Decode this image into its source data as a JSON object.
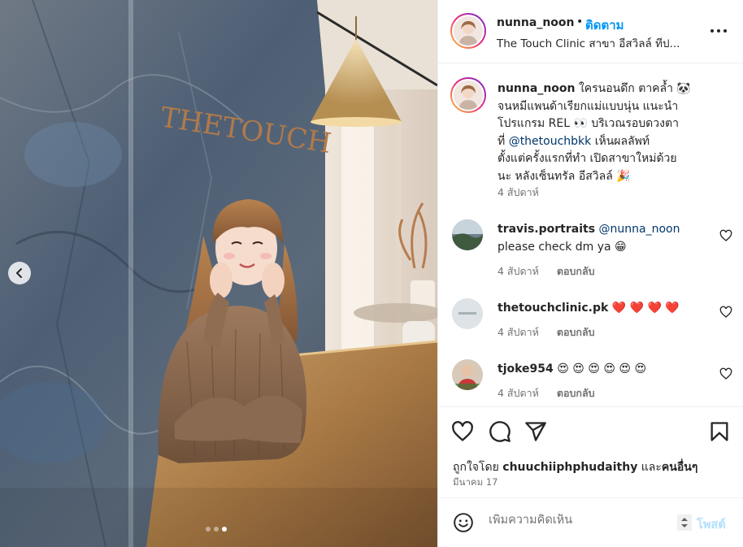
{
  "header": {
    "username": "nunna_noon",
    "separator": "•",
    "follow_label": "ติดตาม",
    "location": "The Touch Clinic สาขา อีสวิลล์ ทีป..."
  },
  "caption": {
    "username": "nunna_noon",
    "text_1": "ใครนอนดึก ตาคล้ำ 🐼",
    "text_2": "จนหมีแพนด้าเรียกแม่แบบนุ่น แนะนำ",
    "text_3": "โปรแกรม REL 👀 บริเวณรอบดวงตา",
    "text_4a": "ที่ ",
    "mention": "@thetouchbkk",
    "text_4b": " เห็นผลลัพท์",
    "text_5": "ตั้งแต่ครั้งแรกที่ทำ เปิดสาขาใหม่ด้วย",
    "text_6": "นะ หลังเซ็นทรัล อีสวิลล์ 🎉",
    "time": "4 สัปดาห์"
  },
  "comments": [
    {
      "username": "travis.portraits",
      "mention": "@nunna_noon",
      "text": "please check dm ya 😁",
      "time": "4 สัปดาห์",
      "reply": "ตอบกลับ"
    },
    {
      "username": "thetouchclinic.pk",
      "text": "❤️ ❤️ ❤️ ❤️",
      "time": "4 สัปดาห์",
      "reply": "ตอบกลับ"
    },
    {
      "username": "tjoke954",
      "text": "😍 😍 😍 😍 😍 😍",
      "time": "4 สัปดาห์",
      "reply": "ตอบกลับ"
    }
  ],
  "actions": {
    "icons": [
      "heart-icon",
      "comment-icon",
      "share-icon",
      "bookmark-icon"
    ],
    "liked_by_prefix": "ถูกใจโดย ",
    "liked_by_user": "chuuchiiphphudaithy",
    "liked_by_and": " และ",
    "liked_by_others": "คนอื่นๆ",
    "date": "มีนาคม 17"
  },
  "add_comment": {
    "placeholder": "เพิ่มความคิดเห็น",
    "post_label": "โพสต์"
  },
  "photo": {
    "sign_text": "THETOUCH",
    "slide_count": 3,
    "active_slide": 3
  },
  "colors": {
    "accent": "#0095f6",
    "mention": "#00376b",
    "muted": "#737373",
    "post_disabled": "#b2dffc",
    "heart": "#ed4956"
  }
}
